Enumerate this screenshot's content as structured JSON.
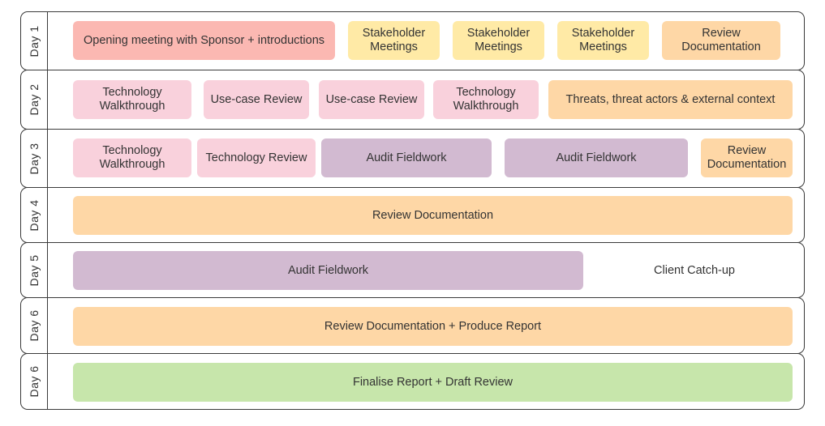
{
  "colors": {
    "red": "#fbb8b2",
    "yellow": "#ffeaa6",
    "orange": "#fed7a6",
    "pink": "#f9d1dc",
    "purple": "#d2bad1",
    "green": "#c7e6ab",
    "none": "transparent"
  },
  "rows": [
    {
      "label": "Day 1",
      "tasks": [
        {
          "text": "Opening meeting with Sponsor + introductions",
          "color": "red"
        },
        {
          "text": "Stakeholder Meetings",
          "color": "yellow"
        },
        {
          "text": "Stakeholder Meetings",
          "color": "yellow"
        },
        {
          "text": "Stakeholder Meetings",
          "color": "yellow"
        },
        {
          "text": "Review Documentation",
          "color": "orange"
        }
      ]
    },
    {
      "label": "Day 2",
      "tasks": [
        {
          "text": "Technology Walkthrough",
          "color": "pink"
        },
        {
          "text": "Use-case Review",
          "color": "pink"
        },
        {
          "text": "Use-case Review",
          "color": "pink"
        },
        {
          "text": "Technology Walkthrough",
          "color": "pink"
        },
        {
          "text": "Threats, threat actors & external context",
          "color": "orange"
        }
      ]
    },
    {
      "label": "Day 3",
      "tasks": [
        {
          "text": "Technology Walkthrough",
          "color": "pink"
        },
        {
          "text": "Technology Review",
          "color": "pink"
        },
        {
          "text": "Audit Fieldwork",
          "color": "purple"
        },
        {
          "text": "Audit Fieldwork",
          "color": "purple"
        },
        {
          "text": "Review Documentation",
          "color": "orange"
        }
      ]
    },
    {
      "label": "Day 4",
      "tasks": [
        {
          "text": "Review Documentation",
          "color": "orange"
        }
      ]
    },
    {
      "label": "Day 5",
      "tasks": [
        {
          "text": "Audit Fieldwork",
          "color": "purple"
        },
        {
          "text": "Client Catch-up",
          "color": "none"
        }
      ]
    },
    {
      "label": "Day 6",
      "tasks": [
        {
          "text": "Review Documentation + Produce Report",
          "color": "orange"
        }
      ]
    },
    {
      "label": "Day 6",
      "tasks": [
        {
          "text": "Finalise Report + Draft Review",
          "color": "green"
        }
      ]
    }
  ]
}
